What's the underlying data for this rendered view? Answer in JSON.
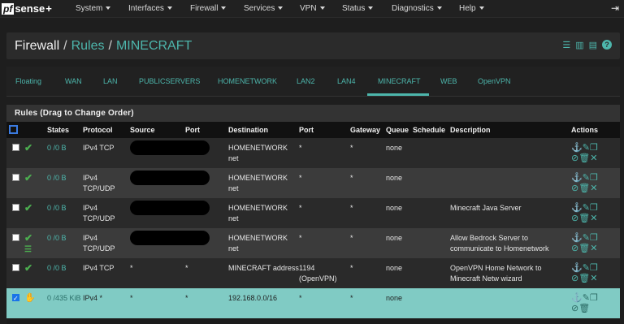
{
  "app": {
    "logo_pf": "pf",
    "logo_sense": "sense"
  },
  "nav": {
    "items": [
      "System",
      "Interfaces",
      "Firewall",
      "Services",
      "VPN",
      "Status",
      "Diagnostics",
      "Help"
    ],
    "logout_icon": "logout-icon"
  },
  "breadcrumb": {
    "root": "Firewall",
    "section": "Rules",
    "current": "MINECRAFT",
    "separator": "/"
  },
  "tabs": [
    "Floating",
    "WAN",
    "LAN",
    "PUBLICSERVERS",
    "HOMENETWORK",
    "LAN2",
    "LAN4",
    "MINECRAFT",
    "WEB",
    "OpenVPN"
  ],
  "active_tab": "MINECRAFT",
  "panel": {
    "title": "Rules (Drag to Change Order)"
  },
  "table": {
    "headers": [
      "",
      "",
      "States",
      "Protocol",
      "Source",
      "Port",
      "Destination",
      "Port",
      "Gateway",
      "Queue",
      "Schedule",
      "Description",
      "Actions"
    ],
    "rows": [
      {
        "states": "0 /0 B",
        "protocol": "IPv4 TCP",
        "source": "",
        "port": "",
        "destination": "HOMENETWORK net",
        "dport": "*",
        "gateway": "*",
        "queue": "none",
        "schedule": "",
        "description": "",
        "checked": false
      },
      {
        "states": "0 /0 B",
        "protocol": "IPv4 TCP/UDP",
        "source": "",
        "port": "",
        "destination": "HOMENETWORK net",
        "dport": "*",
        "gateway": "*",
        "queue": "none",
        "schedule": "",
        "description": "",
        "checked": false
      },
      {
        "states": "0 /0 B",
        "protocol": "IPv4 TCP/UDP",
        "source": "",
        "port": "",
        "destination": "HOMENETWORK net",
        "dport": "*",
        "gateway": "*",
        "queue": "none",
        "schedule": "",
        "description": "Minecraft Java Server",
        "checked": false
      },
      {
        "states": "0 /0 B",
        "protocol": "IPv4 TCP/UDP",
        "source": "",
        "port": "",
        "destination": "HOMENETWORK net",
        "dport": "*",
        "gateway": "*",
        "queue": "none",
        "schedule": "",
        "description": "Allow Bedrock Server to communicate to Homenetwork",
        "checked": false
      },
      {
        "states": "0 /0 B",
        "protocol": "IPv4 TCP",
        "source": "*",
        "port": "*",
        "destination": "MINECRAFT address",
        "dport": "1194 (OpenVPN)",
        "gateway": "*",
        "queue": "none",
        "schedule": "",
        "description": "OpenVPN Home Network to Minecraft Netw wizard",
        "checked": false
      },
      {
        "states": "0 /435 KiB",
        "protocol": "IPv4 *",
        "source": "*",
        "port": "*",
        "destination": "192.168.0.0/16",
        "dport": "*",
        "gateway": "*",
        "queue": "none",
        "schedule": "",
        "description": "",
        "checked": true
      }
    ]
  },
  "colors": {
    "accent": "#4db6ac",
    "pass": "#4caf50",
    "selected_row": "#80cbc4"
  }
}
